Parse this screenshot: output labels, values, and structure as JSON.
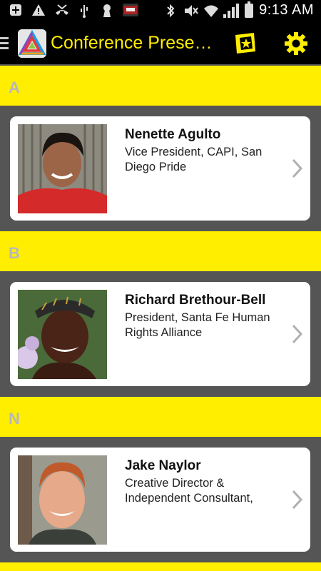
{
  "status_bar": {
    "time": "9:13 AM",
    "icons": [
      "add-icon",
      "warning-icon",
      "missed-call-icon",
      "usb-icon",
      "keyhole-icon",
      "app-notification-icon",
      "bluetooth-icon",
      "mute-icon",
      "wifi-icon",
      "signal-icon",
      "battery-icon"
    ]
  },
  "app_bar": {
    "title": "Conference Presen…",
    "icons": [
      "menu-icon",
      "app-logo",
      "ticket-icon",
      "settings-gear-icon"
    ]
  },
  "colors": {
    "accent_yellow": "#ffee00",
    "background_gray": "#555555",
    "bar_black": "#000000",
    "letter_gray": "#b8b8b8"
  },
  "sections": [
    {
      "letter": "A",
      "presenter": {
        "name": "Nenette Agulto",
        "role": "Vice President, CAPI, San Diego Pride"
      }
    },
    {
      "letter": "B",
      "presenter": {
        "name": "Richard Brethour-Bell",
        "role": "President, Santa Fe Human Rights Alliance"
      }
    },
    {
      "letter": "N",
      "presenter": {
        "name": "Jake Naylor",
        "role": "Creative Director & Independent Consultant,"
      }
    }
  ]
}
